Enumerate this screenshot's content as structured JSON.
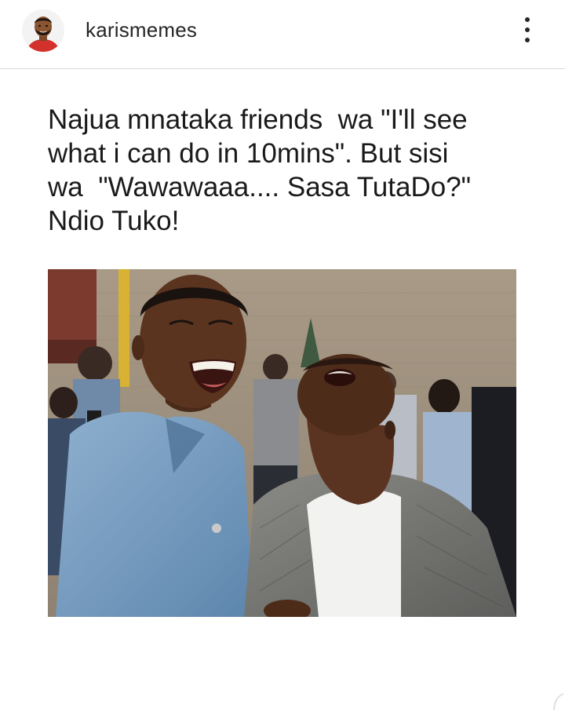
{
  "post": {
    "username": "karismemes",
    "caption_lines": [
      "Najua mnataka friends  wa \"I'll see",
      "what i can do in 10mins\". But sisi",
      "wa  \"Wawawaaa.... Sasa TutaDo?\"",
      "Ndio Tuko!"
    ]
  },
  "icons": {
    "avatar": "cartoon-man-avatar",
    "more": "vertical-ellipsis-icon"
  },
  "colors": {
    "text": "#262626",
    "divider": "#dbdbdb",
    "background": "#ffffff"
  }
}
